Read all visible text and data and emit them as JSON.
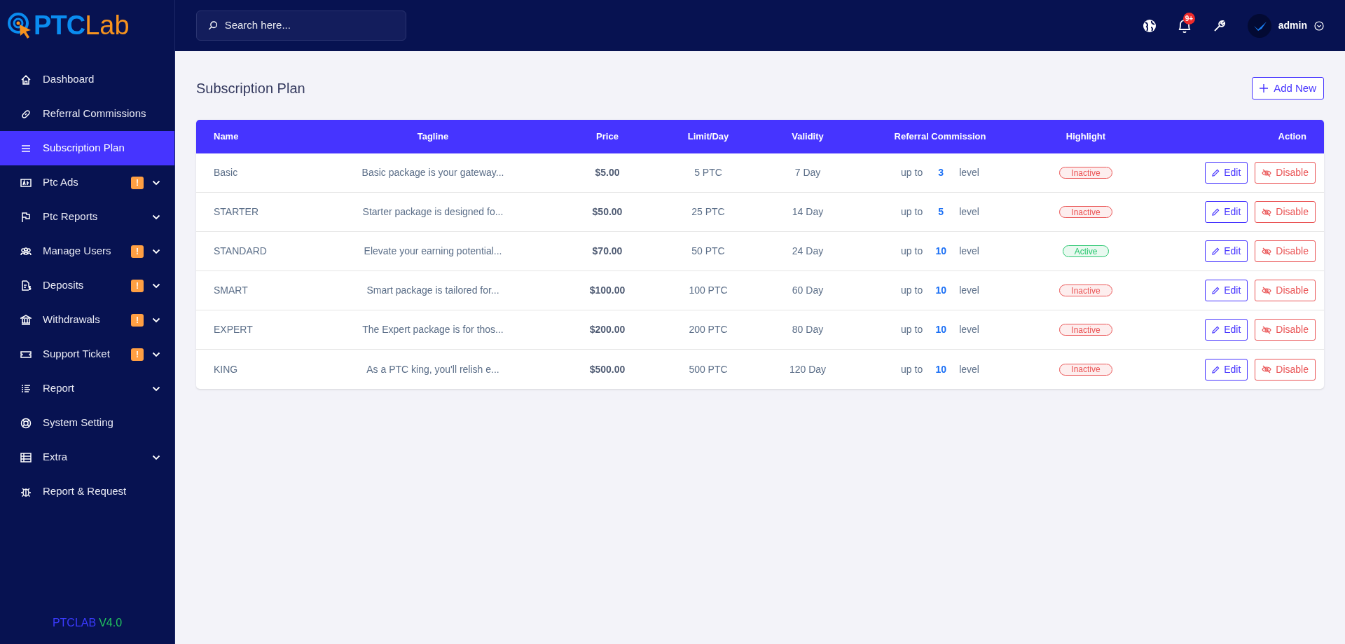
{
  "logo": {
    "mark": "PTC",
    "word": "Lab"
  },
  "sidebar": {
    "items": [
      {
        "label": "Dashboard",
        "selected": false,
        "has_submenu": false
      },
      {
        "label": "Referral Commissions",
        "selected": false,
        "has_submenu": false
      },
      {
        "label": "Subscription Plan",
        "selected": true,
        "has_submenu": false
      },
      {
        "label": "Ptc Ads",
        "selected": false,
        "has_submenu": true,
        "badge": "!"
      },
      {
        "label": "Ptc Reports",
        "selected": false,
        "has_submenu": true
      },
      {
        "label": "Manage Users",
        "selected": false,
        "has_submenu": true,
        "badge": "!"
      },
      {
        "label": "Deposits",
        "selected": false,
        "has_submenu": true,
        "badge": "!"
      },
      {
        "label": "Withdrawals",
        "selected": false,
        "has_submenu": true,
        "badge": "!"
      },
      {
        "label": "Support Ticket",
        "selected": false,
        "has_submenu": true,
        "badge": "!"
      },
      {
        "label": "Report",
        "selected": false,
        "has_submenu": true
      },
      {
        "label": "System Setting",
        "selected": false,
        "has_submenu": false
      },
      {
        "label": "Extra",
        "selected": false,
        "has_submenu": true
      },
      {
        "label": "Report & Request",
        "selected": false,
        "has_submenu": false
      }
    ],
    "footer": {
      "name": "PTCLAB",
      "version": "V4.0"
    }
  },
  "header": {
    "search": {
      "placeholder": "Search here..."
    },
    "notifications_badge": "9+",
    "user": "admin"
  },
  "page": {
    "title": "Subscription Plan",
    "add_button": "Add New"
  },
  "table": {
    "columns": [
      "Name",
      "Tagline",
      "Price",
      "Limit/Day",
      "Validity",
      "Referral Commission",
      "Highlight",
      "Action"
    ],
    "rows": [
      {
        "name": "Basic",
        "tagline": "Basic package is your gateway...",
        "price": "$5.00",
        "limit": "5 PTC",
        "validity": "7 Day",
        "ref_prefix": "up to",
        "ref_level": "3",
        "ref_suffix": "level",
        "highlight": "Inactive",
        "active": false,
        "edit": "Edit",
        "disable": "Disable"
      },
      {
        "name": "STARTER",
        "tagline": "Starter package is designed fo...",
        "price": "$50.00",
        "limit": "25 PTC",
        "validity": "14 Day",
        "ref_prefix": "up to",
        "ref_level": "5",
        "ref_suffix": "level",
        "highlight": "Inactive",
        "active": false,
        "edit": "Edit",
        "disable": "Disable"
      },
      {
        "name": "STANDARD",
        "tagline": "Elevate your earning potential...",
        "price": "$70.00",
        "limit": "50 PTC",
        "validity": "24 Day",
        "ref_prefix": "up to",
        "ref_level": "10",
        "ref_suffix": "level",
        "highlight": "Active",
        "active": true,
        "edit": "Edit",
        "disable": "Disable"
      },
      {
        "name": "SMART",
        "tagline": "Smart package is tailored for...",
        "price": "$100.00",
        "limit": "100 PTC",
        "validity": "60 Day",
        "ref_prefix": "up to",
        "ref_level": "10",
        "ref_suffix": "level",
        "highlight": "Inactive",
        "active": false,
        "edit": "Edit",
        "disable": "Disable"
      },
      {
        "name": "EXPERT",
        "tagline": "The Expert package is for thos...",
        "price": "$200.00",
        "limit": "200 PTC",
        "validity": "80 Day",
        "ref_prefix": "up to",
        "ref_level": "10",
        "ref_suffix": "level",
        "highlight": "Inactive",
        "active": false,
        "edit": "Edit",
        "disable": "Disable"
      },
      {
        "name": "KING",
        "tagline": "As a PTC king, you'll relish e...",
        "price": "$500.00",
        "limit": "500 PTC",
        "validity": "120 Day",
        "ref_prefix": "up to",
        "ref_level": "10",
        "ref_suffix": "level",
        "highlight": "Inactive",
        "active": false,
        "edit": "Edit",
        "disable": "Disable"
      }
    ]
  }
}
